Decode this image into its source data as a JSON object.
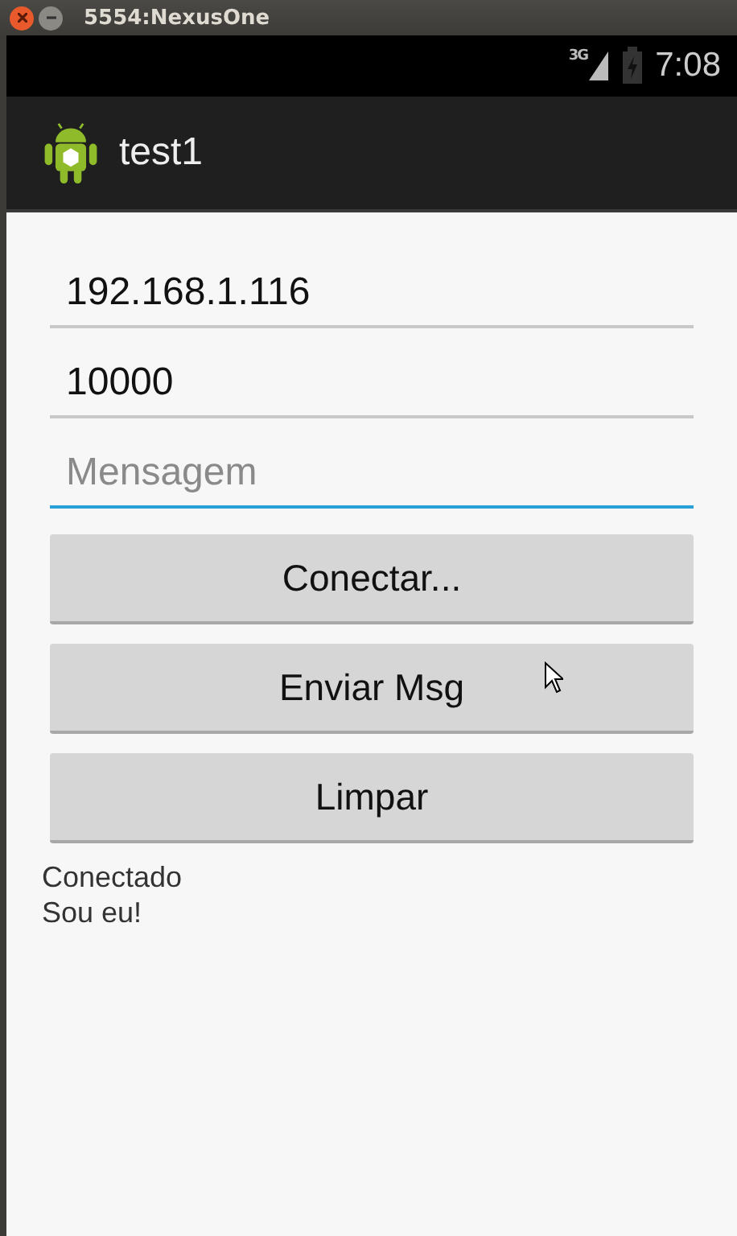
{
  "window": {
    "title": "5554:NexusOne"
  },
  "status_bar": {
    "network": "3G",
    "time": "7:08"
  },
  "action_bar": {
    "title": "test1"
  },
  "fields": [
    {
      "value": "192.168.1.116",
      "focused": false
    },
    {
      "value": "10000",
      "focused": false
    },
    {
      "placeholder": "Mensagem",
      "focused": true
    }
  ],
  "buttons": [
    "Conectar...",
    "Enviar Msg",
    "Limpar"
  ],
  "log": [
    "Conectado",
    "Sou eu!"
  ]
}
